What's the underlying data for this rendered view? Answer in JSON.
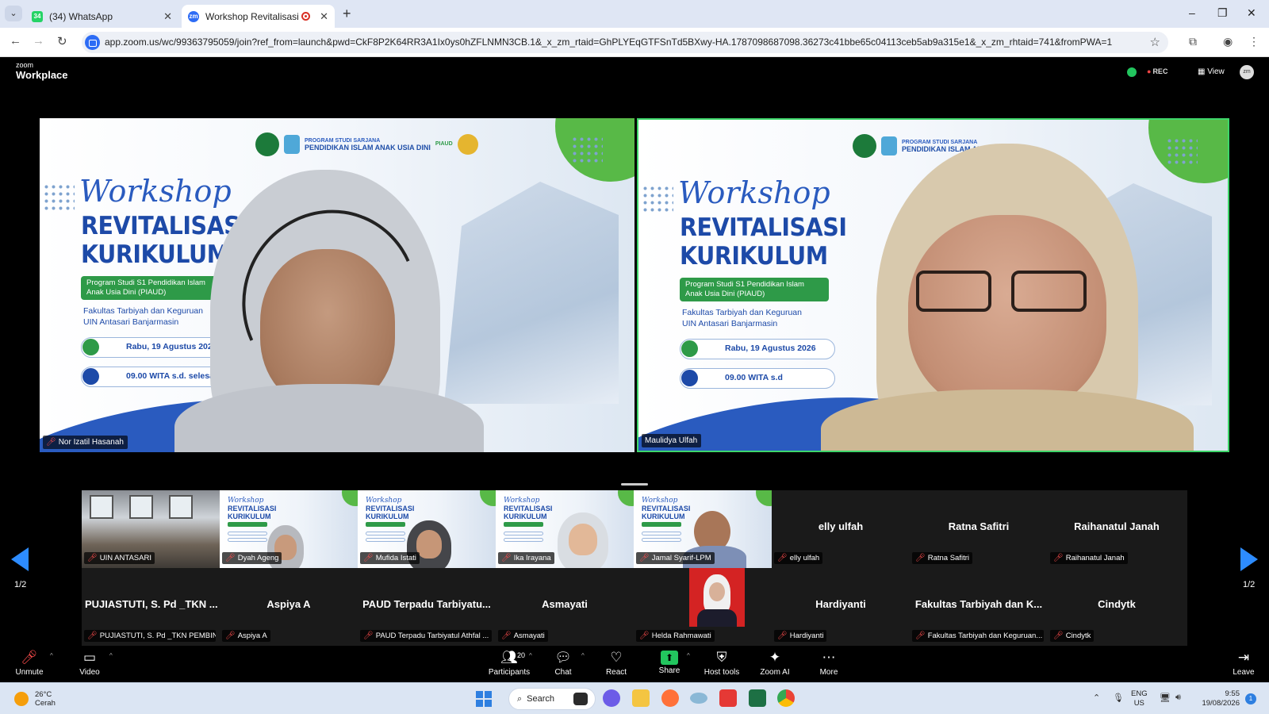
{
  "browser": {
    "tabs": [
      {
        "title": "(34) WhatsApp",
        "badge": "34",
        "icon": "whatsapp-icon"
      },
      {
        "title": "Workshop Revitalisasi Kurik",
        "icon": "zoom-icon",
        "recording": true
      }
    ],
    "url": "app.zoom.us/wc/99363795059/join?ref_from=launch&pwd=CkF8P2K64RR3A1Ix0ys0hZFLNMN3CB.1&_x_zm_rtaid=GhPLYEqGTFSnTd5BXwy-HA.1787098687098.36273c41bbe65c04113ceb5ab9a315e1&_x_zm_rhtaid=741&fromPWA=1",
    "window_controls": [
      "–",
      "❐",
      "✕"
    ]
  },
  "zoom_header": {
    "logo_small": "zoom",
    "logo_big": "Workplace",
    "rec_label": "REC",
    "view_label": "View"
  },
  "slide": {
    "workshop": "Workshop",
    "title_line1": "REVITALISASI",
    "title_line2": "KURIKULUM",
    "program_line1": "Program Studi S1 Pendidikan Islam",
    "program_line2": "Anak Usia Dini (PIAUD)",
    "faculty_line1": "Fakultas Tarbiyah dan Keguruan",
    "faculty_line2": "UIN Antasari Banjarmasin",
    "date": "Rabu, 19 Agustus 2026",
    "time": "09.00 WITA s.d. selesai",
    "time_partial": "09.00 WITA s.d",
    "logo_caption_small": "PROGRAM STUDI SARJANA",
    "logo_caption_big": "PENDIDIKAN ISLAM ANAK USIA DINI",
    "logo_tag": "PIAUD"
  },
  "speakers": [
    {
      "name": "Nor Izatil Hasanah",
      "muted": true
    },
    {
      "name": "Maulidya Ulfah",
      "muted": false,
      "active": true
    }
  ],
  "gallery": {
    "row1": [
      {
        "name": "UIN ANTASARI",
        "type": "room"
      },
      {
        "name": "Dyah Ageng",
        "type": "slide"
      },
      {
        "name": "Mufida Istati",
        "type": "slide"
      },
      {
        "name": "Ika Irayana",
        "type": "slide"
      },
      {
        "name": "Jamal Syarif-LPM",
        "type": "slide"
      },
      {
        "name": "elly ulfah",
        "display": "elly ulfah",
        "type": "name"
      },
      {
        "name": "Ratna Safitri",
        "display": "Ratna Safitri",
        "type": "name"
      },
      {
        "name": "Raihanatul Janah",
        "display": "Raihanatul Janah",
        "type": "name"
      }
    ],
    "row2": [
      {
        "name": "PUJIASTUTI, S. Pd _TKN PEMBIN...",
        "display": "PUJIASTUTI, S. Pd _TKN ...",
        "type": "name"
      },
      {
        "name": "Aspiya A",
        "display": "Aspiya A",
        "type": "name"
      },
      {
        "name": "PAUD Terpadu Tarbiyatul Athfal ...",
        "display": "PAUD Terpadu Tarbiyatu...",
        "type": "name"
      },
      {
        "name": "Asmayati",
        "display": "Asmayati",
        "type": "name"
      },
      {
        "name": "Helda Rahmawati",
        "type": "photo"
      },
      {
        "name": "Hardiyanti",
        "display": "Hardiyanti",
        "type": "name"
      },
      {
        "name": "Fakultas Tarbiyah dan Keguruan...",
        "display": "Fakultas Tarbiyah dan K...",
        "type": "name"
      },
      {
        "name": "Cindytk",
        "display": "Cindytk",
        "type": "name"
      }
    ],
    "page_left": "1/2",
    "page_right": "1/2"
  },
  "toolbar": {
    "unmute": "Unmute",
    "video": "Video",
    "participants": "Participants",
    "participant_count": "20",
    "chat": "Chat",
    "react": "React",
    "share": "Share",
    "host_tools": "Host tools",
    "zoom_ai": "Zoom AI",
    "more": "More",
    "leave": "Leave"
  },
  "taskbar": {
    "weather_temp": "26°C",
    "weather_desc": "Cerah",
    "search": "Search",
    "lang_line1": "ENG",
    "lang_line2": "US",
    "time": "9:55",
    "date": "19/08/2026",
    "notifications": "1"
  },
  "colors": {
    "active_speaker_border": "#3ed66a",
    "muted_icon": "#ff4d4d",
    "zoom_blue": "#2d8cff",
    "share_green": "#22c55e"
  }
}
